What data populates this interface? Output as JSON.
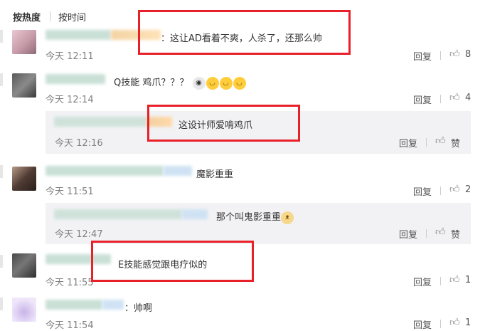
{
  "sort_tabs": {
    "hot": "按热度",
    "time": "按时间"
  },
  "actions": {
    "reply": "回复",
    "like": "赞"
  },
  "colors": {
    "highlight_box": "#e8202a",
    "reply_bg": "#f2f2f5"
  },
  "comments": [
    {
      "text": "：这让AD看着不爽，人杀了，还那么帅",
      "time": "今天 12:11",
      "likes": "8"
    },
    {
      "text": "Q技能    鸡爪？？？",
      "emojis": [
        "surprised-emoji",
        "grin-emoji",
        "grin-emoji",
        "grin-emoji"
      ],
      "time": "今天 12:14",
      "likes": "4"
    },
    {
      "reply": true,
      "text": "这设计师爱啃鸡爪",
      "time": "今天 12:16"
    },
    {
      "text": "魔影重重",
      "time": "今天 11:51",
      "likes": "2"
    },
    {
      "reply": true,
      "text": "那个叫鬼影重重",
      "emojis": [
        "dog-emoji"
      ],
      "time": "今天 12:47"
    },
    {
      "text": "E技能感觉跟电疗似的",
      "time": "今天 11:55",
      "likes": "1"
    },
    {
      "text": "：帅啊",
      "time": "今天 11:54",
      "likes": "1"
    }
  ]
}
